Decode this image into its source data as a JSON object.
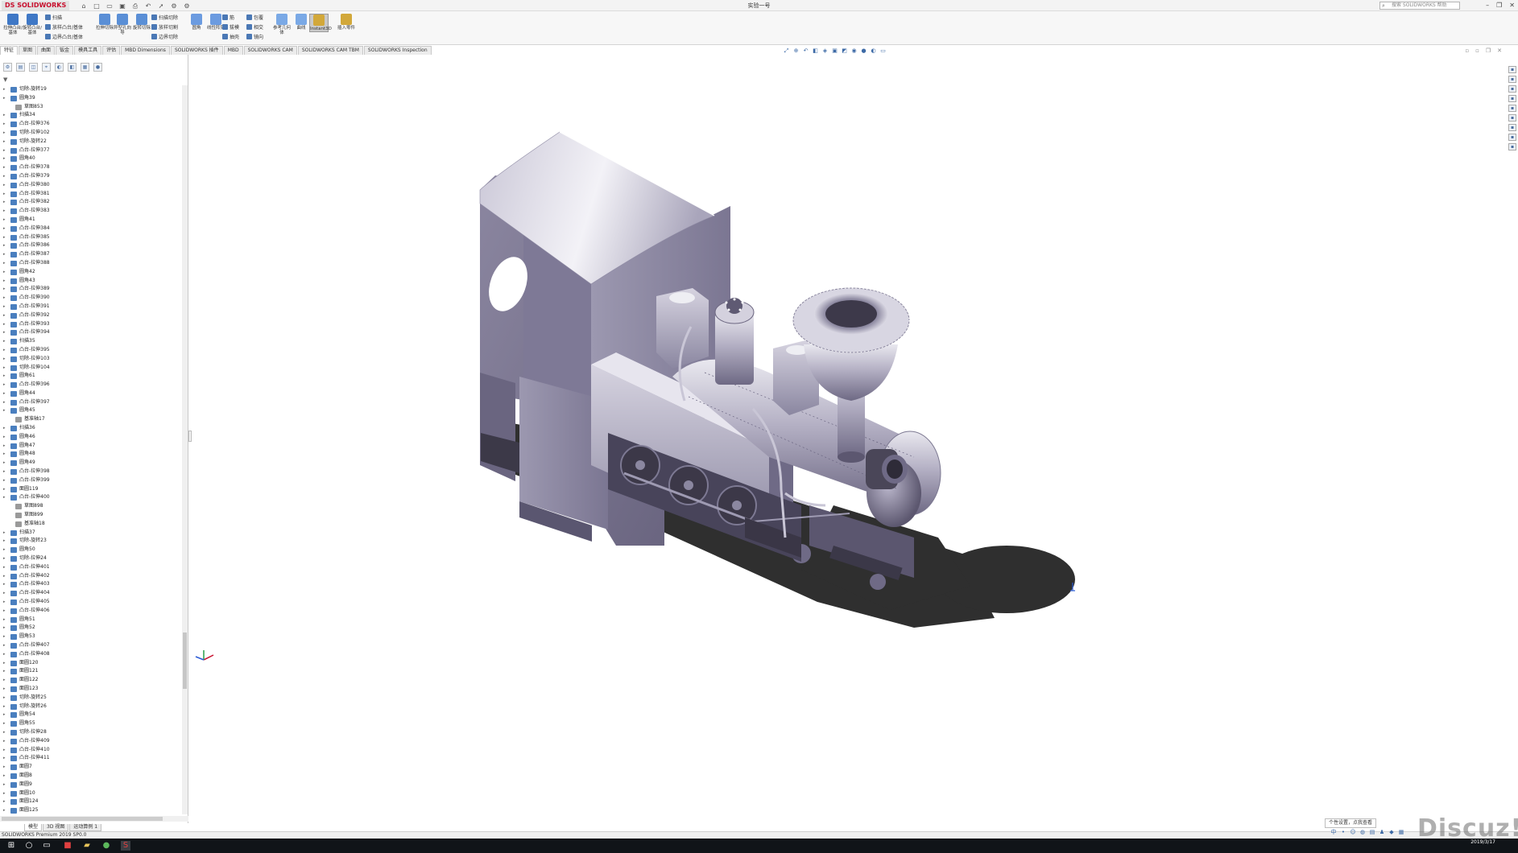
{
  "app": {
    "logo_text": "DS SOLIDWORKS",
    "doc_title": "实验一号",
    "search_placeholder": "搜索 SOLIDWORKS 帮助",
    "window_controls": [
      "–",
      "❐",
      "✕"
    ]
  },
  "qat_icons": [
    "home-icon",
    "new-icon",
    "open-icon",
    "save-icon",
    "print-icon",
    "undo-icon",
    "select-icon",
    "rebuild-icon",
    "options-icon"
  ],
  "ribbon": {
    "large": [
      {
        "label": "拉伸凸台/基体",
        "color": "#3f78c6"
      },
      {
        "label": "旋转凸台/基体",
        "color": "#3f78c6"
      },
      {
        "label": "拉伸切除",
        "color": "#5a8fd6"
      },
      {
        "label": "异型孔向导",
        "color": "#5a8fd6"
      },
      {
        "label": "旋转切除",
        "color": "#5a8fd6"
      },
      {
        "label": "圆角",
        "color": "#6b9be0"
      },
      {
        "label": "线性阵列",
        "color": "#6b9be0"
      },
      {
        "label": "参考几何体",
        "color": "#7aa9e6"
      },
      {
        "label": "曲线",
        "color": "#7aa9e6"
      },
      {
        "label": "Instant3D",
        "color": "#d2a83a"
      },
      {
        "label": "插入零件",
        "color": "#d2a83a"
      }
    ],
    "small_col1": [
      "扫描",
      "放样凸台/基体",
      "边界凸台/基体"
    ],
    "small_col2": [
      "扫描切除",
      "放样切割",
      "边界切除"
    ],
    "small_col3": [
      "筋",
      "拔模",
      "抽壳"
    ],
    "small_col4": [
      "包覆",
      "相交",
      "镜向"
    ]
  },
  "cm_tabs": [
    "特征",
    "草图",
    "曲面",
    "钣金",
    "模具工具",
    "评估",
    "MBD Dimensions",
    "SOLIDWORKS 插件",
    "MBD",
    "SOLIDWORKS CAM",
    "SOLIDWORKS CAM TBM",
    "SOLIDWORKS Inspection"
  ],
  "cm_active_tab": "特征",
  "fm_tabs": [
    "feature-tree",
    "property",
    "config",
    "dimxpert",
    "display",
    "cam",
    "cam-ops",
    "appearance"
  ],
  "tree": [
    {
      "label": "切除-旋转19",
      "c": "#4a7fbf",
      "sub": false
    },
    {
      "label": "圆角39",
      "c": "#4a7fbf",
      "sub": false
    },
    {
      "label": "草图853",
      "c": "#9a9a9a",
      "sub": true
    },
    {
      "label": "扫描34",
      "c": "#4a7fbf",
      "sub": false
    },
    {
      "label": "凸台-拉伸376",
      "c": "#4a7fbf",
      "sub": false
    },
    {
      "label": "切除-拉伸102",
      "c": "#4a7fbf",
      "sub": false
    },
    {
      "label": "切除-旋转22",
      "c": "#4a7fbf",
      "sub": false
    },
    {
      "label": "凸台-拉伸377",
      "c": "#4a7fbf",
      "sub": false
    },
    {
      "label": "圆角40",
      "c": "#4a7fbf",
      "sub": false
    },
    {
      "label": "凸台-拉伸378",
      "c": "#4a7fbf",
      "sub": false
    },
    {
      "label": "凸台-拉伸379",
      "c": "#4a7fbf",
      "sub": false
    },
    {
      "label": "凸台-拉伸380",
      "c": "#4a7fbf",
      "sub": false
    },
    {
      "label": "凸台-拉伸381",
      "c": "#4a7fbf",
      "sub": false
    },
    {
      "label": "凸台-拉伸382",
      "c": "#4a7fbf",
      "sub": false
    },
    {
      "label": "凸台-拉伸383",
      "c": "#4a7fbf",
      "sub": false
    },
    {
      "label": "圆角41",
      "c": "#4a7fbf",
      "sub": false
    },
    {
      "label": "凸台-拉伸384",
      "c": "#4a7fbf",
      "sub": false
    },
    {
      "label": "凸台-拉伸385",
      "c": "#4a7fbf",
      "sub": false
    },
    {
      "label": "凸台-拉伸386",
      "c": "#4a7fbf",
      "sub": false
    },
    {
      "label": "凸台-拉伸387",
      "c": "#4a7fbf",
      "sub": false
    },
    {
      "label": "凸台-拉伸388",
      "c": "#4a7fbf",
      "sub": false
    },
    {
      "label": "圆角42",
      "c": "#4a7fbf",
      "sub": false
    },
    {
      "label": "圆角43",
      "c": "#4a7fbf",
      "sub": false
    },
    {
      "label": "凸台-拉伸389",
      "c": "#4a7fbf",
      "sub": false
    },
    {
      "label": "凸台-拉伸390",
      "c": "#4a7fbf",
      "sub": false
    },
    {
      "label": "凸台-拉伸391",
      "c": "#4a7fbf",
      "sub": false
    },
    {
      "label": "凸台-拉伸392",
      "c": "#4a7fbf",
      "sub": false
    },
    {
      "label": "凸台-拉伸393",
      "c": "#4a7fbf",
      "sub": false
    },
    {
      "label": "凸台-拉伸394",
      "c": "#4a7fbf",
      "sub": false
    },
    {
      "label": "扫描35",
      "c": "#4a7fbf",
      "sub": false
    },
    {
      "label": "凸台-拉伸395",
      "c": "#4a7fbf",
      "sub": false
    },
    {
      "label": "切除-拉伸103",
      "c": "#4a7fbf",
      "sub": false
    },
    {
      "label": "切除-拉伸104",
      "c": "#4a7fbf",
      "sub": false
    },
    {
      "label": "圆角61",
      "c": "#4a7fbf",
      "sub": false
    },
    {
      "label": "凸台-拉伸396",
      "c": "#4a7fbf",
      "sub": false
    },
    {
      "label": "圆角44",
      "c": "#4a7fbf",
      "sub": false
    },
    {
      "label": "凸台-拉伸397",
      "c": "#4a7fbf",
      "sub": false
    },
    {
      "label": "圆角45",
      "c": "#4a7fbf",
      "sub": false
    },
    {
      "label": "基准轴17",
      "c": "#9a9a9a",
      "sub": true
    },
    {
      "label": "扫描36",
      "c": "#4a7fbf",
      "sub": false
    },
    {
      "label": "圆角46",
      "c": "#4a7fbf",
      "sub": false
    },
    {
      "label": "圆角47",
      "c": "#4a7fbf",
      "sub": false
    },
    {
      "label": "圆角48",
      "c": "#4a7fbf",
      "sub": false
    },
    {
      "label": "圆角49",
      "c": "#4a7fbf",
      "sub": false
    },
    {
      "label": "凸台-拉伸398",
      "c": "#4a7fbf",
      "sub": false
    },
    {
      "label": "凸台-拉伸399",
      "c": "#4a7fbf",
      "sub": false
    },
    {
      "label": "面圆119",
      "c": "#4a7fbf",
      "sub": false
    },
    {
      "label": "凸台-拉伸400",
      "c": "#4a7fbf",
      "sub": false
    },
    {
      "label": "草图898",
      "c": "#9a9a9a",
      "sub": true
    },
    {
      "label": "草图899",
      "c": "#9a9a9a",
      "sub": true
    },
    {
      "label": "基准轴18",
      "c": "#9a9a9a",
      "sub": true
    },
    {
      "label": "扫描37",
      "c": "#4a7fbf",
      "sub": false
    },
    {
      "label": "切除-旋转23",
      "c": "#4a7fbf",
      "sub": false
    },
    {
      "label": "圆角50",
      "c": "#4a7fbf",
      "sub": false
    },
    {
      "label": "切除-拉伸24",
      "c": "#4a7fbf",
      "sub": false
    },
    {
      "label": "凸台-拉伸401",
      "c": "#4a7fbf",
      "sub": false
    },
    {
      "label": "凸台-拉伸402",
      "c": "#4a7fbf",
      "sub": false
    },
    {
      "label": "凸台-拉伸403",
      "c": "#4a7fbf",
      "sub": false
    },
    {
      "label": "凸台-拉伸404",
      "c": "#4a7fbf",
      "sub": false
    },
    {
      "label": "凸台-拉伸405",
      "c": "#4a7fbf",
      "sub": false
    },
    {
      "label": "凸台-拉伸406",
      "c": "#4a7fbf",
      "sub": false
    },
    {
      "label": "圆角51",
      "c": "#4a7fbf",
      "sub": false
    },
    {
      "label": "圆角52",
      "c": "#4a7fbf",
      "sub": false
    },
    {
      "label": "圆角53",
      "c": "#4a7fbf",
      "sub": false
    },
    {
      "label": "凸台-拉伸407",
      "c": "#4a7fbf",
      "sub": false
    },
    {
      "label": "凸台-拉伸408",
      "c": "#4a7fbf",
      "sub": false
    },
    {
      "label": "面圆120",
      "c": "#4a7fbf",
      "sub": false
    },
    {
      "label": "面圆121",
      "c": "#4a7fbf",
      "sub": false
    },
    {
      "label": "面圆122",
      "c": "#4a7fbf",
      "sub": false
    },
    {
      "label": "面圆123",
      "c": "#4a7fbf",
      "sub": false
    },
    {
      "label": "切除-旋转25",
      "c": "#4a7fbf",
      "sub": false
    },
    {
      "label": "切除-旋转26",
      "c": "#4a7fbf",
      "sub": false
    },
    {
      "label": "圆角54",
      "c": "#4a7fbf",
      "sub": false
    },
    {
      "label": "圆角55",
      "c": "#4a7fbf",
      "sub": false
    },
    {
      "label": "切除-拉伸28",
      "c": "#4a7fbf",
      "sub": false
    },
    {
      "label": "凸台-拉伸409",
      "c": "#4a7fbf",
      "sub": false
    },
    {
      "label": "凸台-拉伸410",
      "c": "#4a7fbf",
      "sub": false
    },
    {
      "label": "凸台-拉伸411",
      "c": "#4a7fbf",
      "sub": false
    },
    {
      "label": "面圆7",
      "c": "#4a7fbf",
      "sub": false
    },
    {
      "label": "面圆8",
      "c": "#4a7fbf",
      "sub": false
    },
    {
      "label": "面圆9",
      "c": "#4a7fbf",
      "sub": false
    },
    {
      "label": "面圆10",
      "c": "#4a7fbf",
      "sub": false
    },
    {
      "label": "面圆124",
      "c": "#4a7fbf",
      "sub": false
    },
    {
      "label": "面圆125",
      "c": "#4a7fbf",
      "sub": false
    }
  ],
  "bottom_tabs": [
    "模型",
    "3D 视图",
    "运动算例 1"
  ],
  "bottom_active": "模型",
  "status": {
    "left": "SOLIDWORKS Premium 2019 SP0.0",
    "tip": "个性设置，点我查看"
  },
  "watermark": "Discuz!",
  "taskbar": {
    "time": "",
    "date": "2019/3/17",
    "apps": [
      "start-icon",
      "search-icon",
      "app-red-icon",
      "folder-icon",
      "chrome-icon",
      "solidworks-icon"
    ]
  },
  "colors": {
    "body_light": "#b9b5c9",
    "body_mid": "#8f8aa4",
    "body_dark": "#5c5770",
    "shadow": "#2e2e2e"
  }
}
